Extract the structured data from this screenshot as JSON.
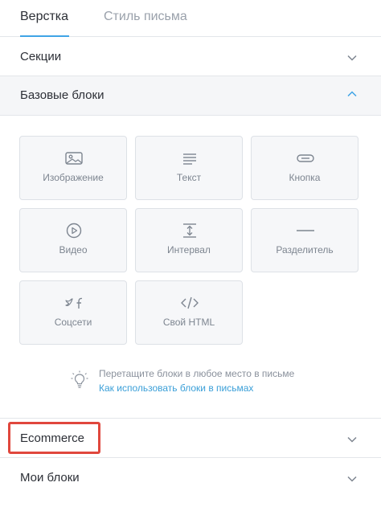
{
  "tabs": [
    {
      "label": "Верстка",
      "active": true
    },
    {
      "label": "Стиль письма",
      "active": false
    }
  ],
  "sections": {
    "sections_label": "Секции",
    "basic_label": "Базовые блоки",
    "ecommerce_label": "Ecommerce",
    "my_blocks_label": "Мои блоки"
  },
  "blocks": [
    {
      "label": "Изображение",
      "icon": "image-icon"
    },
    {
      "label": "Текст",
      "icon": "text-icon"
    },
    {
      "label": "Кнопка",
      "icon": "button-icon"
    },
    {
      "label": "Видео",
      "icon": "play-icon"
    },
    {
      "label": "Интервал",
      "icon": "spacing-icon"
    },
    {
      "label": "Разделитель",
      "icon": "divider-icon"
    },
    {
      "label": "Соцсети",
      "icon": "social-icon"
    },
    {
      "label": "Свой HTML",
      "icon": "code-icon"
    }
  ],
  "hint": {
    "text": "Перетащите блоки в любое место в письме",
    "link": "Как использовать блоки в письмах",
    "icon": "lightbulb-icon"
  },
  "colors": {
    "accent": "#3fa4e6",
    "highlight": "#e0473d",
    "link": "#3a9fd8"
  }
}
